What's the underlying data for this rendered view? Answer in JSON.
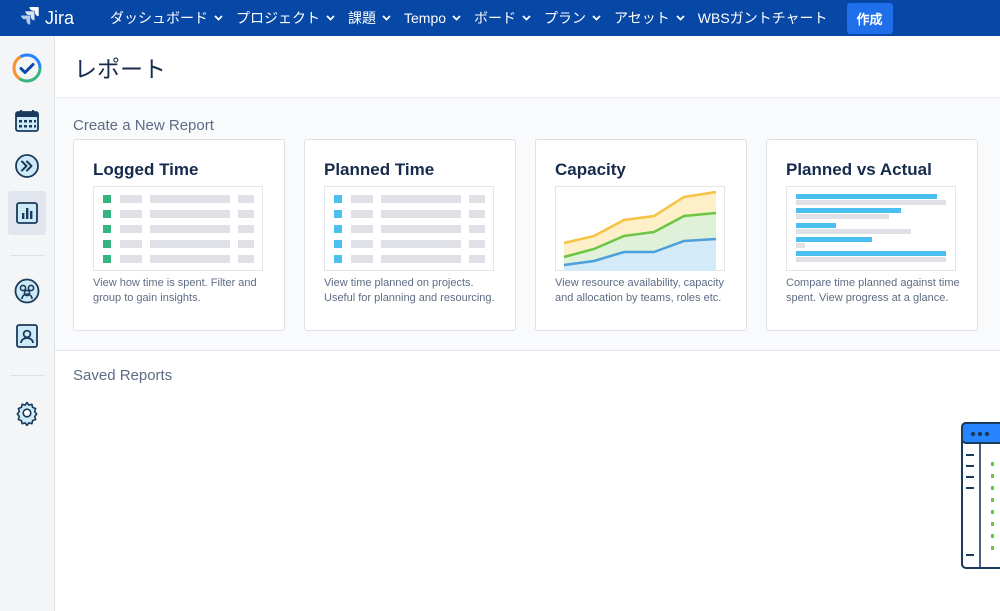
{
  "app": {
    "name": "Jira"
  },
  "nav": {
    "items": [
      {
        "label": "ダッシュボード"
      },
      {
        "label": "プロジェクト"
      },
      {
        "label": "課題"
      },
      {
        "label": "Tempo"
      },
      {
        "label": "ボード"
      },
      {
        "label": "プラン"
      },
      {
        "label": "アセット"
      }
    ],
    "wbs_label": "WBSガントチャート",
    "create_label": "作成"
  },
  "page": {
    "title": "レポート",
    "create_section_label": "Create a New Report",
    "saved_section_label": "Saved Reports"
  },
  "cards": [
    {
      "title": "Logged Time",
      "desc": "View how time is spent. Filter and group to gain insights."
    },
    {
      "title": "Planned Time",
      "desc": "View time planned on projects. Useful for planning and resourcing."
    },
    {
      "title": "Capacity",
      "desc": "View resource availability, capacity and allocation by teams, roles etc."
    },
    {
      "title": "Planned vs Actual",
      "desc": "Compare time planned against time spent. View progress at a glance."
    }
  ],
  "colors": {
    "nav_bg": "#0747a6",
    "create_btn": "#1f6fea",
    "logged_square": "#36b37e",
    "planned_square": "#4bc0f0",
    "capacity_orange": "#f6c342",
    "capacity_green": "#6cc644",
    "capacity_blue": "#4a9fdc"
  },
  "icons": {
    "sidebar": [
      "tempo-logo-icon",
      "calendar-icon",
      "forward-icon",
      "reports-icon",
      "teams-icon",
      "user-icon",
      "gear-icon"
    ]
  }
}
